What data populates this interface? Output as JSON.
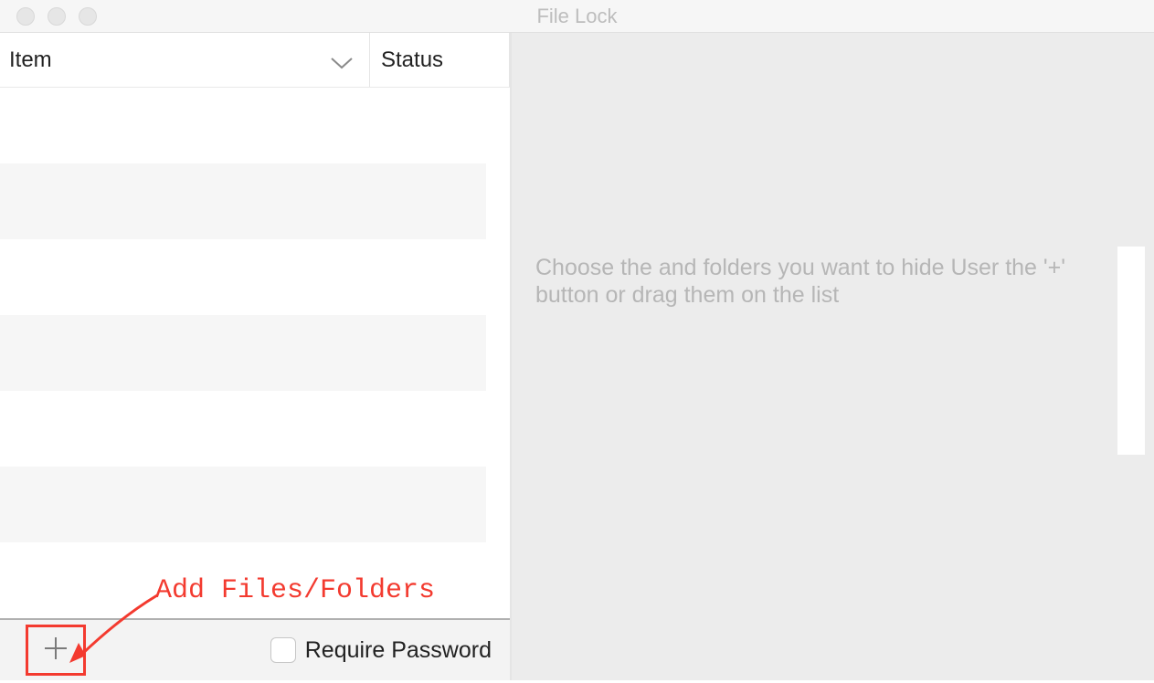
{
  "window": {
    "title": "File Lock"
  },
  "table": {
    "headers": {
      "item": "Item",
      "status": "Status"
    },
    "rows": []
  },
  "bottom": {
    "add_icon": "plus-icon",
    "require_password_label": "Require Password",
    "require_password_checked": false
  },
  "right": {
    "hint": "Choose the and folders you want to hide User the '+' button or drag them on the list"
  },
  "annotation": {
    "label": "Add Files/Folders"
  }
}
